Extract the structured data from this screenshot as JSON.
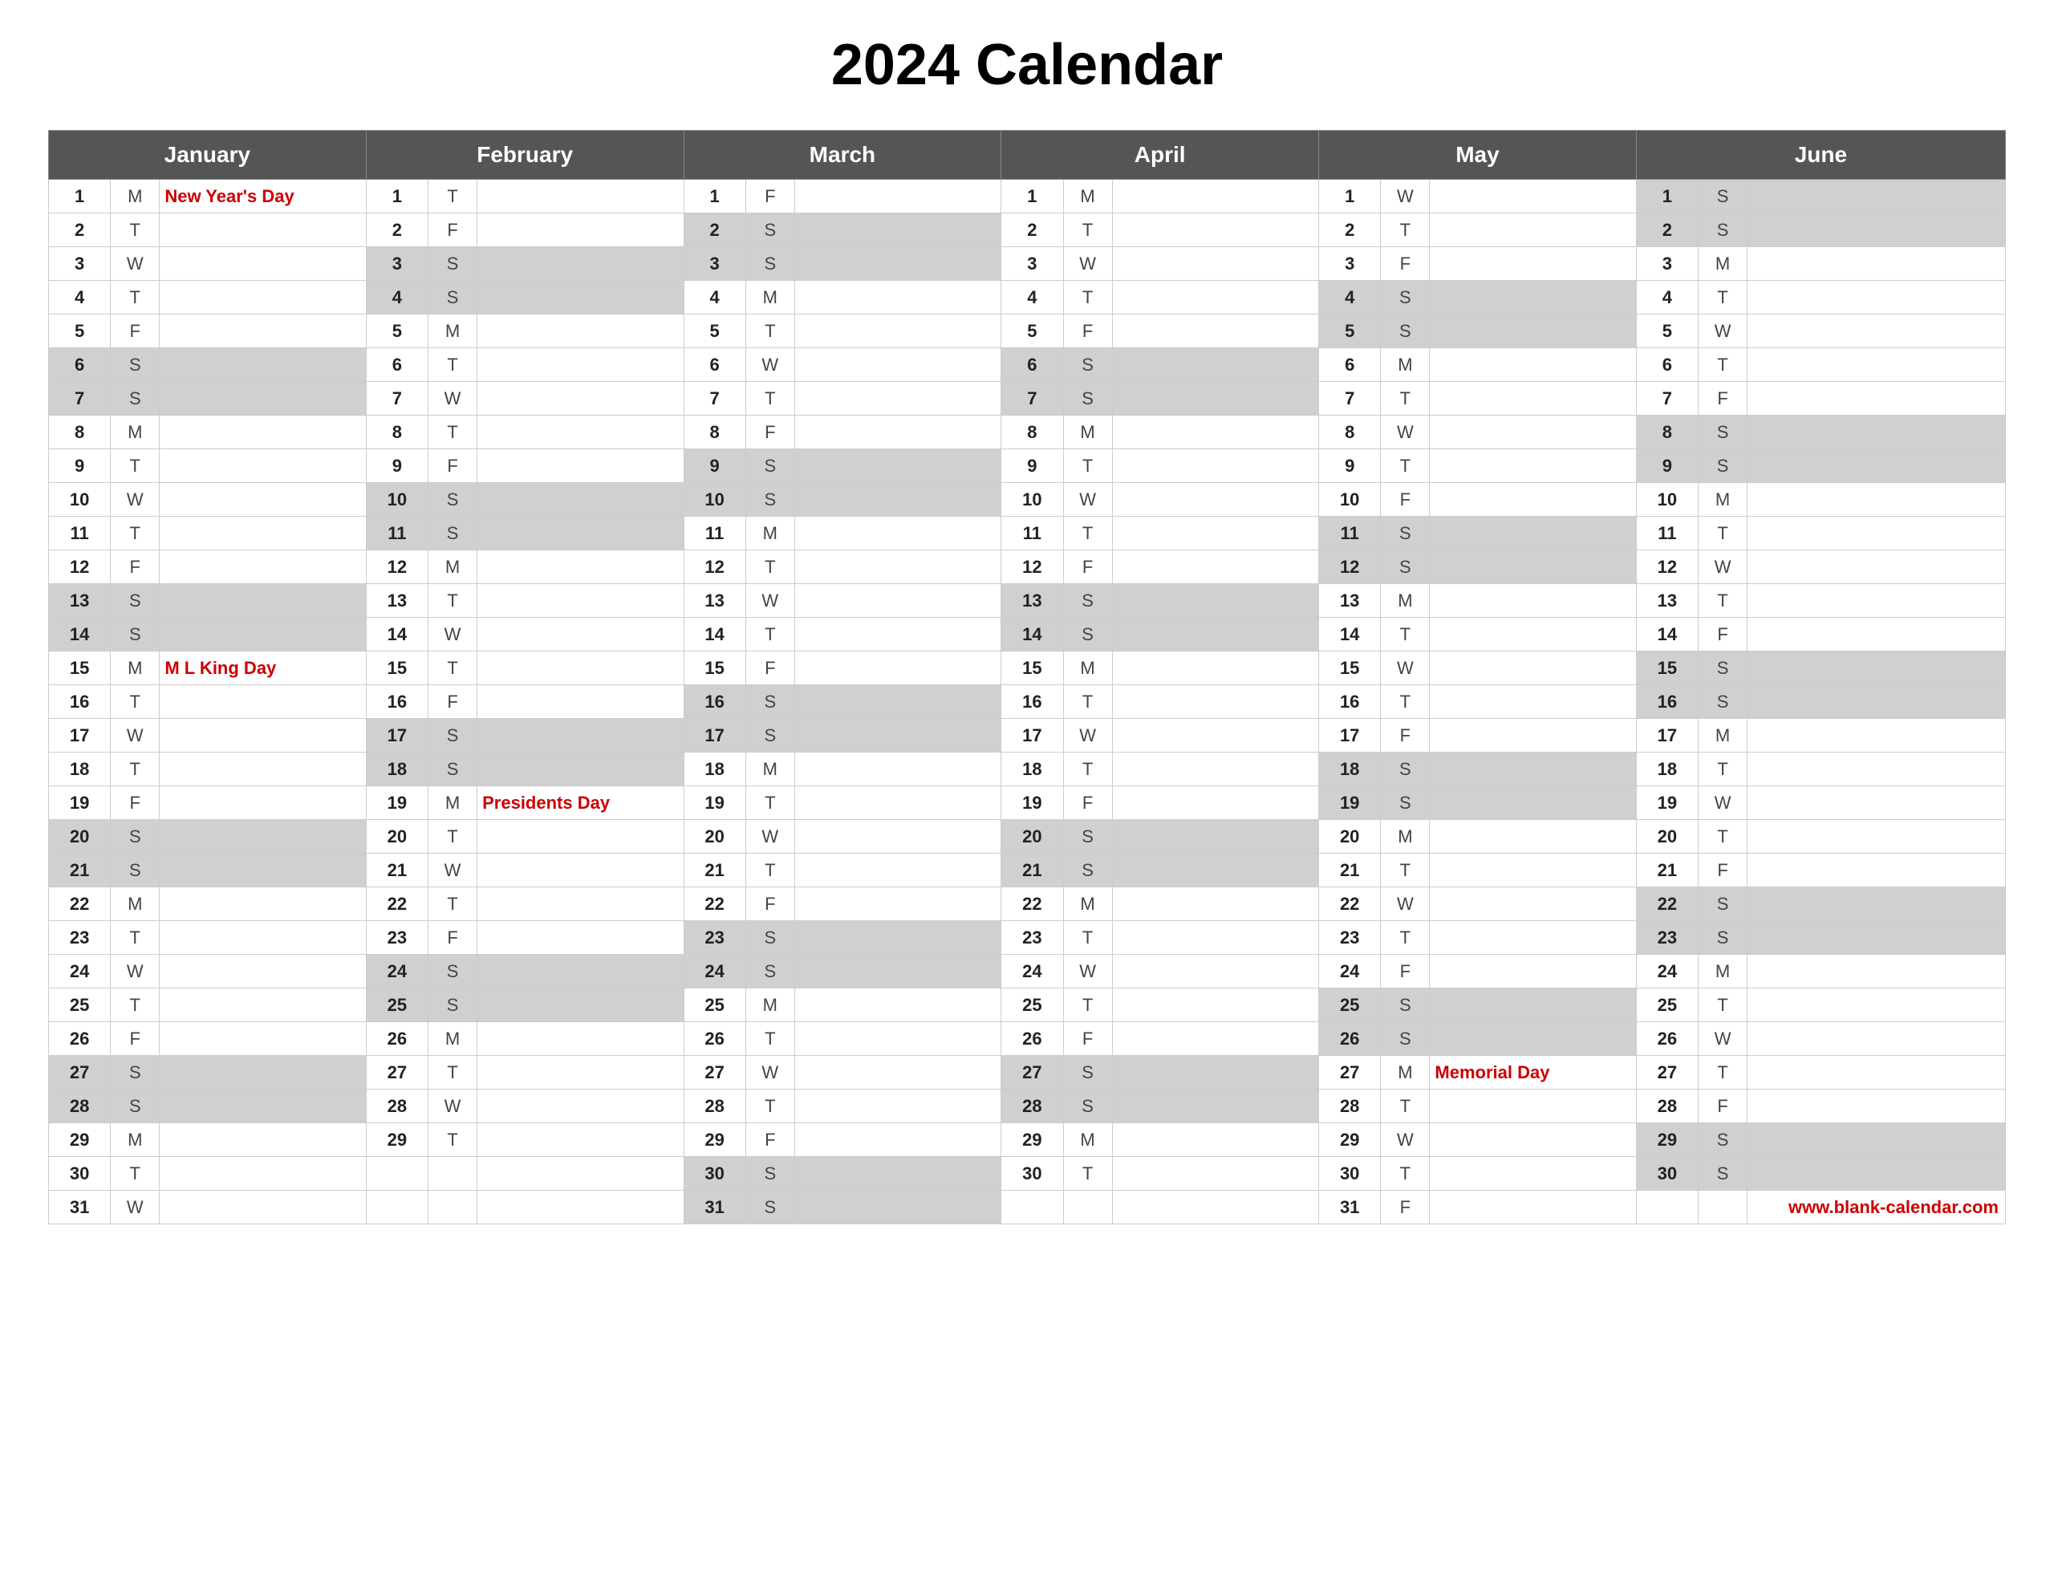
{
  "title": "2024 Calendar",
  "website": "www.blank-calendar.com",
  "months": [
    {
      "name": "January",
      "colspan": 3
    },
    {
      "name": "February",
      "colspan": 3
    },
    {
      "name": "March",
      "colspan": 3
    },
    {
      "name": "April",
      "colspan": 3
    },
    {
      "name": "May",
      "colspan": 3
    },
    {
      "name": "June",
      "colspan": 3
    }
  ],
  "days": {
    "1": {
      "jan": {
        "d": "M",
        "e": "New Year's Day",
        "holiday": true
      },
      "feb": {
        "d": "T",
        "e": ""
      },
      "mar": {
        "d": "F",
        "e": ""
      },
      "apr": {
        "d": "M",
        "e": ""
      },
      "may": {
        "d": "W",
        "e": ""
      },
      "jun": {
        "d": "S",
        "e": "",
        "weekend": true
      }
    },
    "2": {
      "jan": {
        "d": "T",
        "e": ""
      },
      "feb": {
        "d": "F",
        "e": ""
      },
      "mar": {
        "d": "S",
        "e": "",
        "weekend": true
      },
      "apr": {
        "d": "T",
        "e": ""
      },
      "may": {
        "d": "T",
        "e": ""
      },
      "jun": {
        "d": "S",
        "e": "",
        "weekend": true
      }
    },
    "3": {
      "jan": {
        "d": "W",
        "e": ""
      },
      "feb": {
        "d": "S",
        "e": "",
        "weekend": true
      },
      "mar": {
        "d": "S",
        "e": "",
        "weekend": true
      },
      "apr": {
        "d": "W",
        "e": ""
      },
      "may": {
        "d": "F",
        "e": ""
      },
      "jun": {
        "d": "M",
        "e": ""
      }
    },
    "4": {
      "jan": {
        "d": "T",
        "e": ""
      },
      "feb": {
        "d": "S",
        "e": "",
        "weekend": true
      },
      "mar": {
        "d": "M",
        "e": ""
      },
      "apr": {
        "d": "T",
        "e": ""
      },
      "may": {
        "d": "S",
        "e": "",
        "weekend": true
      },
      "jun": {
        "d": "T",
        "e": ""
      }
    },
    "5": {
      "jan": {
        "d": "F",
        "e": ""
      },
      "feb": {
        "d": "M",
        "e": ""
      },
      "mar": {
        "d": "T",
        "e": ""
      },
      "apr": {
        "d": "F",
        "e": ""
      },
      "may": {
        "d": "S",
        "e": "",
        "weekend": true
      },
      "jun": {
        "d": "W",
        "e": ""
      }
    },
    "6": {
      "jan": {
        "d": "S",
        "e": "",
        "weekend": true
      },
      "feb": {
        "d": "T",
        "e": ""
      },
      "mar": {
        "d": "W",
        "e": ""
      },
      "apr": {
        "d": "S",
        "e": "",
        "weekend": true
      },
      "may": {
        "d": "M",
        "e": ""
      },
      "jun": {
        "d": "T",
        "e": ""
      }
    },
    "7": {
      "jan": {
        "d": "S",
        "e": "",
        "weekend": true
      },
      "feb": {
        "d": "W",
        "e": ""
      },
      "mar": {
        "d": "T",
        "e": ""
      },
      "apr": {
        "d": "S",
        "e": "",
        "weekend": true
      },
      "may": {
        "d": "T",
        "e": ""
      },
      "jun": {
        "d": "F",
        "e": ""
      }
    },
    "8": {
      "jan": {
        "d": "M",
        "e": ""
      },
      "feb": {
        "d": "T",
        "e": ""
      },
      "mar": {
        "d": "F",
        "e": ""
      },
      "apr": {
        "d": "M",
        "e": ""
      },
      "may": {
        "d": "W",
        "e": ""
      },
      "jun": {
        "d": "S",
        "e": "",
        "weekend": true
      }
    },
    "9": {
      "jan": {
        "d": "T",
        "e": ""
      },
      "feb": {
        "d": "F",
        "e": ""
      },
      "mar": {
        "d": "S",
        "e": "",
        "weekend": true
      },
      "apr": {
        "d": "T",
        "e": ""
      },
      "may": {
        "d": "T",
        "e": ""
      },
      "jun": {
        "d": "S",
        "e": "",
        "weekend": true
      }
    },
    "10": {
      "jan": {
        "d": "W",
        "e": ""
      },
      "feb": {
        "d": "S",
        "e": "",
        "weekend": true
      },
      "mar": {
        "d": "S",
        "e": "",
        "weekend": true
      },
      "apr": {
        "d": "W",
        "e": ""
      },
      "may": {
        "d": "F",
        "e": ""
      },
      "jun": {
        "d": "M",
        "e": ""
      }
    },
    "11": {
      "jan": {
        "d": "T",
        "e": ""
      },
      "feb": {
        "d": "S",
        "e": "",
        "weekend": true
      },
      "mar": {
        "d": "M",
        "e": ""
      },
      "apr": {
        "d": "T",
        "e": ""
      },
      "may": {
        "d": "S",
        "e": "",
        "weekend": true
      },
      "jun": {
        "d": "T",
        "e": ""
      }
    },
    "12": {
      "jan": {
        "d": "F",
        "e": ""
      },
      "feb": {
        "d": "M",
        "e": ""
      },
      "mar": {
        "d": "T",
        "e": ""
      },
      "apr": {
        "d": "F",
        "e": ""
      },
      "may": {
        "d": "S",
        "e": "",
        "weekend": true
      },
      "jun": {
        "d": "W",
        "e": ""
      }
    },
    "13": {
      "jan": {
        "d": "S",
        "e": "",
        "weekend": true
      },
      "feb": {
        "d": "T",
        "e": ""
      },
      "mar": {
        "d": "W",
        "e": ""
      },
      "apr": {
        "d": "S",
        "e": "",
        "weekend": true
      },
      "may": {
        "d": "M",
        "e": ""
      },
      "jun": {
        "d": "T",
        "e": ""
      }
    },
    "14": {
      "jan": {
        "d": "S",
        "e": "",
        "weekend": true
      },
      "feb": {
        "d": "W",
        "e": ""
      },
      "mar": {
        "d": "T",
        "e": ""
      },
      "apr": {
        "d": "S",
        "e": "",
        "weekend": true
      },
      "may": {
        "d": "T",
        "e": ""
      },
      "jun": {
        "d": "F",
        "e": ""
      }
    },
    "15": {
      "jan": {
        "d": "M",
        "e": "M L King Day",
        "holiday": true
      },
      "feb": {
        "d": "T",
        "e": ""
      },
      "mar": {
        "d": "F",
        "e": ""
      },
      "apr": {
        "d": "M",
        "e": ""
      },
      "may": {
        "d": "W",
        "e": ""
      },
      "jun": {
        "d": "S",
        "e": "",
        "weekend": true
      }
    },
    "16": {
      "jan": {
        "d": "T",
        "e": ""
      },
      "feb": {
        "d": "F",
        "e": ""
      },
      "mar": {
        "d": "S",
        "e": "",
        "weekend": true
      },
      "apr": {
        "d": "T",
        "e": ""
      },
      "may": {
        "d": "T",
        "e": ""
      },
      "jun": {
        "d": "S",
        "e": "",
        "weekend": true
      }
    },
    "17": {
      "jan": {
        "d": "W",
        "e": ""
      },
      "feb": {
        "d": "S",
        "e": "",
        "weekend": true
      },
      "mar": {
        "d": "S",
        "e": "",
        "weekend": true
      },
      "apr": {
        "d": "W",
        "e": ""
      },
      "may": {
        "d": "F",
        "e": ""
      },
      "jun": {
        "d": "M",
        "e": ""
      }
    },
    "18": {
      "jan": {
        "d": "T",
        "e": ""
      },
      "feb": {
        "d": "S",
        "e": "",
        "weekend": true
      },
      "mar": {
        "d": "M",
        "e": ""
      },
      "apr": {
        "d": "T",
        "e": ""
      },
      "may": {
        "d": "S",
        "e": "",
        "weekend": true
      },
      "jun": {
        "d": "T",
        "e": ""
      }
    },
    "19": {
      "jan": {
        "d": "F",
        "e": ""
      },
      "feb": {
        "d": "M",
        "e": "Presidents Day",
        "holiday": true
      },
      "mar": {
        "d": "T",
        "e": ""
      },
      "apr": {
        "d": "F",
        "e": ""
      },
      "may": {
        "d": "S",
        "e": "",
        "weekend": true
      },
      "jun": {
        "d": "W",
        "e": ""
      }
    },
    "20": {
      "jan": {
        "d": "S",
        "e": "",
        "weekend": true
      },
      "feb": {
        "d": "T",
        "e": ""
      },
      "mar": {
        "d": "W",
        "e": ""
      },
      "apr": {
        "d": "S",
        "e": "",
        "weekend": true
      },
      "may": {
        "d": "M",
        "e": ""
      },
      "jun": {
        "d": "T",
        "e": ""
      }
    },
    "21": {
      "jan": {
        "d": "S",
        "e": "",
        "weekend": true
      },
      "feb": {
        "d": "W",
        "e": ""
      },
      "mar": {
        "d": "T",
        "e": ""
      },
      "apr": {
        "d": "S",
        "e": "",
        "weekend": true
      },
      "may": {
        "d": "T",
        "e": ""
      },
      "jun": {
        "d": "F",
        "e": ""
      }
    },
    "22": {
      "jan": {
        "d": "M",
        "e": ""
      },
      "feb": {
        "d": "T",
        "e": ""
      },
      "mar": {
        "d": "F",
        "e": ""
      },
      "apr": {
        "d": "M",
        "e": ""
      },
      "may": {
        "d": "W",
        "e": ""
      },
      "jun": {
        "d": "S",
        "e": "",
        "weekend": true
      }
    },
    "23": {
      "jan": {
        "d": "T",
        "e": ""
      },
      "feb": {
        "d": "F",
        "e": ""
      },
      "mar": {
        "d": "S",
        "e": "",
        "weekend": true
      },
      "apr": {
        "d": "T",
        "e": ""
      },
      "may": {
        "d": "T",
        "e": ""
      },
      "jun": {
        "d": "S",
        "e": "",
        "weekend": true
      }
    },
    "24": {
      "jan": {
        "d": "W",
        "e": ""
      },
      "feb": {
        "d": "S",
        "e": "",
        "weekend": true
      },
      "mar": {
        "d": "S",
        "e": "",
        "weekend": true
      },
      "apr": {
        "d": "W",
        "e": ""
      },
      "may": {
        "d": "F",
        "e": ""
      },
      "jun": {
        "d": "M",
        "e": ""
      }
    },
    "25": {
      "jan": {
        "d": "T",
        "e": ""
      },
      "feb": {
        "d": "S",
        "e": "",
        "weekend": true
      },
      "mar": {
        "d": "M",
        "e": ""
      },
      "apr": {
        "d": "T",
        "e": ""
      },
      "may": {
        "d": "S",
        "e": "",
        "weekend": true
      },
      "jun": {
        "d": "T",
        "e": ""
      }
    },
    "26": {
      "jan": {
        "d": "F",
        "e": ""
      },
      "feb": {
        "d": "M",
        "e": ""
      },
      "mar": {
        "d": "T",
        "e": ""
      },
      "apr": {
        "d": "F",
        "e": ""
      },
      "may": {
        "d": "S",
        "e": "",
        "weekend": true
      },
      "jun": {
        "d": "W",
        "e": ""
      }
    },
    "27": {
      "jan": {
        "d": "S",
        "e": "",
        "weekend": true
      },
      "feb": {
        "d": "T",
        "e": ""
      },
      "mar": {
        "d": "W",
        "e": ""
      },
      "apr": {
        "d": "S",
        "e": "",
        "weekend": true
      },
      "may": {
        "d": "M",
        "e": "Memorial Day",
        "holiday": true
      },
      "jun": {
        "d": "T",
        "e": ""
      }
    },
    "28": {
      "jan": {
        "d": "S",
        "e": "",
        "weekend": true
      },
      "feb": {
        "d": "W",
        "e": ""
      },
      "mar": {
        "d": "T",
        "e": ""
      },
      "apr": {
        "d": "S",
        "e": "",
        "weekend": true
      },
      "may": {
        "d": "T",
        "e": ""
      },
      "jun": {
        "d": "F",
        "e": ""
      }
    },
    "29": {
      "jan": {
        "d": "M",
        "e": ""
      },
      "feb": {
        "d": "T",
        "e": ""
      },
      "mar": {
        "d": "F",
        "e": ""
      },
      "apr": {
        "d": "M",
        "e": ""
      },
      "may": {
        "d": "W",
        "e": ""
      },
      "jun": {
        "d": "S",
        "e": "",
        "weekend": true
      }
    },
    "30": {
      "jan": {
        "d": "T",
        "e": ""
      },
      "feb": null,
      "mar": {
        "d": "S",
        "e": "",
        "weekend": true
      },
      "apr": {
        "d": "T",
        "e": ""
      },
      "may": {
        "d": "T",
        "e": ""
      },
      "jun": {
        "d": "S",
        "e": "",
        "weekend": true
      }
    },
    "31": {
      "jan": {
        "d": "W",
        "e": ""
      },
      "feb": null,
      "mar": {
        "d": "S",
        "e": "",
        "weekend": true
      },
      "apr": null,
      "may": {
        "d": "F",
        "e": ""
      },
      "jun": null
    }
  }
}
